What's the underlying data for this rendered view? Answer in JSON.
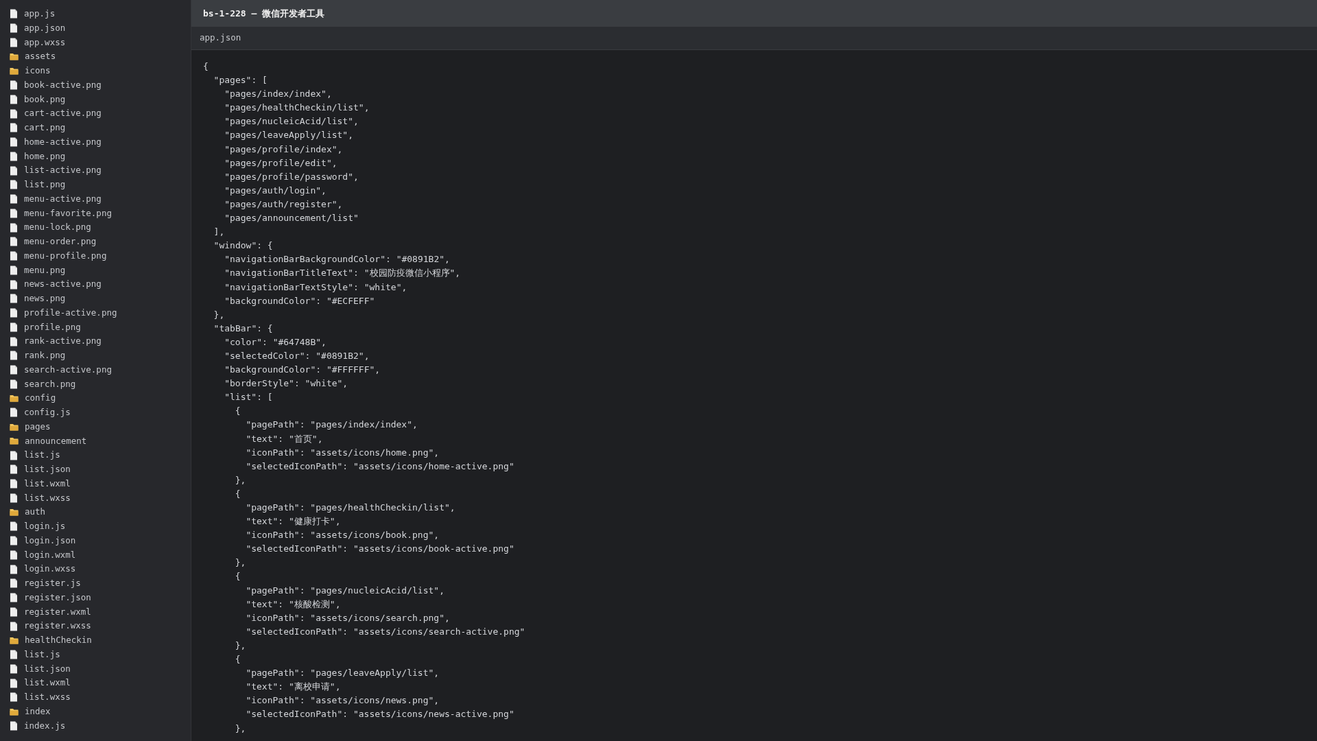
{
  "window": {
    "title": "bs-1-228 — 微信开发者工具"
  },
  "sidebar": {
    "items": [
      {
        "kind": "file",
        "label": "app.js"
      },
      {
        "kind": "file",
        "label": "app.json"
      },
      {
        "kind": "file",
        "label": "app.wxss"
      },
      {
        "kind": "folder",
        "label": "assets"
      },
      {
        "kind": "folder",
        "label": "icons"
      },
      {
        "kind": "file",
        "label": "book-active.png"
      },
      {
        "kind": "file",
        "label": "book.png"
      },
      {
        "kind": "file",
        "label": "cart-active.png"
      },
      {
        "kind": "file",
        "label": "cart.png"
      },
      {
        "kind": "file",
        "label": "home-active.png"
      },
      {
        "kind": "file",
        "label": "home.png"
      },
      {
        "kind": "file",
        "label": "list-active.png"
      },
      {
        "kind": "file",
        "label": "list.png"
      },
      {
        "kind": "file",
        "label": "menu-active.png"
      },
      {
        "kind": "file",
        "label": "menu-favorite.png"
      },
      {
        "kind": "file",
        "label": "menu-lock.png"
      },
      {
        "kind": "file",
        "label": "menu-order.png"
      },
      {
        "kind": "file",
        "label": "menu-profile.png"
      },
      {
        "kind": "file",
        "label": "menu.png"
      },
      {
        "kind": "file",
        "label": "news-active.png"
      },
      {
        "kind": "file",
        "label": "news.png"
      },
      {
        "kind": "file",
        "label": "profile-active.png"
      },
      {
        "kind": "file",
        "label": "profile.png"
      },
      {
        "kind": "file",
        "label": "rank-active.png"
      },
      {
        "kind": "file",
        "label": "rank.png"
      },
      {
        "kind": "file",
        "label": "search-active.png"
      },
      {
        "kind": "file",
        "label": "search.png"
      },
      {
        "kind": "folder",
        "label": "config"
      },
      {
        "kind": "file",
        "label": "config.js"
      },
      {
        "kind": "folder",
        "label": "pages"
      },
      {
        "kind": "folder",
        "label": "announcement"
      },
      {
        "kind": "file",
        "label": "list.js"
      },
      {
        "kind": "file",
        "label": "list.json"
      },
      {
        "kind": "file",
        "label": "list.wxml"
      },
      {
        "kind": "file",
        "label": "list.wxss"
      },
      {
        "kind": "folder",
        "label": "auth"
      },
      {
        "kind": "file",
        "label": "login.js"
      },
      {
        "kind": "file",
        "label": "login.json"
      },
      {
        "kind": "file",
        "label": "login.wxml"
      },
      {
        "kind": "file",
        "label": "login.wxss"
      },
      {
        "kind": "file",
        "label": "register.js"
      },
      {
        "kind": "file",
        "label": "register.json"
      },
      {
        "kind": "file",
        "label": "register.wxml"
      },
      {
        "kind": "file",
        "label": "register.wxss"
      },
      {
        "kind": "folder",
        "label": "healthCheckin"
      },
      {
        "kind": "file",
        "label": "list.js"
      },
      {
        "kind": "file",
        "label": "list.json"
      },
      {
        "kind": "file",
        "label": "list.wxml"
      },
      {
        "kind": "file",
        "label": "list.wxss"
      },
      {
        "kind": "folder",
        "label": "index"
      },
      {
        "kind": "file",
        "label": "index.js"
      }
    ]
  },
  "editor": {
    "tab": "app.json",
    "lines": [
      {
        "text": "{",
        "children": [
          {
            "text": "\"pages\": [",
            "children": [
              {
                "text": "\"pages/index/index\","
              },
              {
                "text": "\"pages/healthCheckin/list\","
              },
              {
                "text": "\"pages/nucleicAcid/list\","
              },
              {
                "text": "\"pages/leaveApply/list\","
              },
              {
                "text": "\"pages/profile/index\","
              },
              {
                "text": "\"pages/profile/edit\","
              },
              {
                "text": "\"pages/profile/password\","
              },
              {
                "text": "\"pages/auth/login\","
              },
              {
                "text": "\"pages/auth/register\","
              },
              {
                "text": "\"pages/announcement/list\""
              }
            ]
          },
          {
            "text": "],"
          },
          {
            "text": "\"window\": {",
            "children": [
              {
                "text": "\"navigationBarBackgroundColor\": \"#0891B2\","
              },
              {
                "text": "\"navigationBarTitleText\": \"校园防疫微信小程序\","
              },
              {
                "text": "\"navigationBarTextStyle\": \"white\","
              },
              {
                "text": "\"backgroundColor\": \"#ECFEFF\""
              }
            ]
          },
          {
            "text": "},"
          },
          {
            "text": "\"tabBar\": {",
            "children": [
              {
                "text": "\"color\": \"#64748B\","
              },
              {
                "text": "\"selectedColor\": \"#0891B2\","
              },
              {
                "text": "\"backgroundColor\": \"#FFFFFF\","
              },
              {
                "text": "\"borderStyle\": \"white\","
              },
              {
                "text": "\"list\": [",
                "children": [
                  {
                    "text": "{",
                    "children": [
                      {
                        "text": "\"pagePath\": \"pages/index/index\","
                      },
                      {
                        "text": "\"text\": \"首页\","
                      },
                      {
                        "text": "\"iconPath\": \"assets/icons/home.png\","
                      },
                      {
                        "text": "\"selectedIconPath\": \"assets/icons/home-active.png\""
                      }
                    ]
                  },
                  {
                    "text": "},"
                  },
                  {
                    "text": "{",
                    "children": [
                      {
                        "text": "\"pagePath\": \"pages/healthCheckin/list\","
                      },
                      {
                        "text": "\"text\": \"健康打卡\","
                      },
                      {
                        "text": "\"iconPath\": \"assets/icons/book.png\","
                      },
                      {
                        "text": "\"selectedIconPath\": \"assets/icons/book-active.png\""
                      }
                    ]
                  },
                  {
                    "text": "},"
                  },
                  {
                    "text": "{",
                    "children": [
                      {
                        "text": "\"pagePath\": \"pages/nucleicAcid/list\","
                      },
                      {
                        "text": "\"text\": \"核酸检测\","
                      },
                      {
                        "text": "\"iconPath\": \"assets/icons/search.png\","
                      },
                      {
                        "text": "\"selectedIconPath\": \"assets/icons/search-active.png\""
                      }
                    ]
                  },
                  {
                    "text": "},"
                  },
                  {
                    "text": "{",
                    "children": [
                      {
                        "text": "\"pagePath\": \"pages/leaveApply/list\","
                      },
                      {
                        "text": "\"text\": \"离校申请\","
                      },
                      {
                        "text": "\"iconPath\": \"assets/icons/news.png\","
                      },
                      {
                        "text": "\"selectedIconPath\": \"assets/icons/news-active.png\""
                      }
                    ]
                  },
                  {
                    "text": "},"
                  }
                ]
              }
            ]
          }
        ]
      }
    ]
  }
}
